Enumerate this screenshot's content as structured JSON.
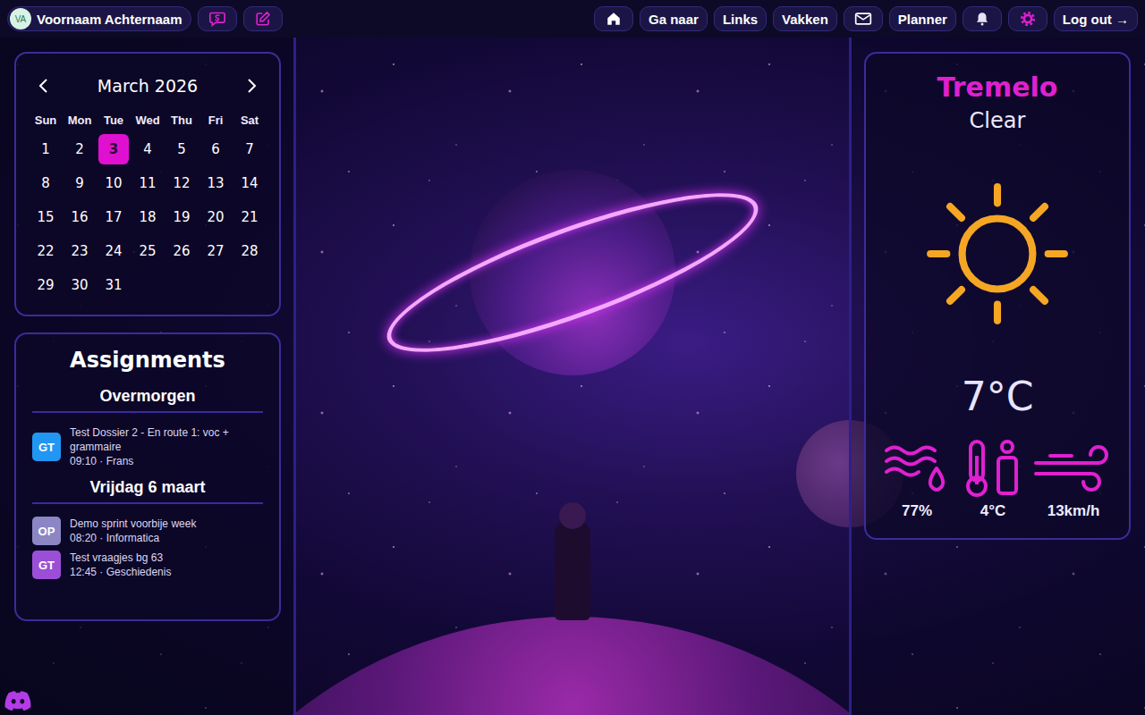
{
  "user": {
    "initials": "VA",
    "name": "Voornaam Achternaam"
  },
  "nav": [
    {
      "kind": "icon"
    },
    {
      "kind": "text",
      "label": "Ga naar"
    },
    {
      "kind": "text",
      "label": "Links"
    },
    {
      "kind": "text",
      "label": "Vakken"
    },
    {
      "kind": "icon"
    },
    {
      "kind": "text",
      "label": "Planner"
    },
    {
      "kind": "icon"
    },
    {
      "kind": "icon"
    },
    {
      "kind": "text",
      "label": "Log out →"
    }
  ],
  "calendar": {
    "month": "March 2026",
    "weekdays": [
      "Sun",
      "Mon",
      "Tue",
      "Wed",
      "Thu",
      "Fri",
      "Sat"
    ],
    "days": [
      {
        "label": "1",
        "selected": false
      },
      {
        "label": "2",
        "selected": false
      },
      {
        "label": "3",
        "selected": true
      },
      {
        "label": "4",
        "selected": false
      },
      {
        "label": "5",
        "selected": false
      },
      {
        "label": "6",
        "selected": false
      },
      {
        "label": "7",
        "selected": false
      },
      {
        "label": "8",
        "selected": false
      },
      {
        "label": "9",
        "selected": false
      },
      {
        "label": "10",
        "selected": false
      },
      {
        "label": "11",
        "selected": false
      },
      {
        "label": "12",
        "selected": false
      },
      {
        "label": "13",
        "selected": false
      },
      {
        "label": "14",
        "selected": false
      },
      {
        "label": "15",
        "selected": false
      },
      {
        "label": "16",
        "selected": false
      },
      {
        "label": "17",
        "selected": false
      },
      {
        "label": "18",
        "selected": false
      },
      {
        "label": "19",
        "selected": false
      },
      {
        "label": "20",
        "selected": false
      },
      {
        "label": "21",
        "selected": false
      },
      {
        "label": "22",
        "selected": false
      },
      {
        "label": "23",
        "selected": false
      },
      {
        "label": "24",
        "selected": false
      },
      {
        "label": "25",
        "selected": false
      },
      {
        "label": "26",
        "selected": false
      },
      {
        "label": "27",
        "selected": false
      },
      {
        "label": "28",
        "selected": false
      },
      {
        "label": "29",
        "selected": false
      },
      {
        "label": "30",
        "selected": false
      },
      {
        "label": "31",
        "selected": false
      }
    ]
  },
  "assignments": {
    "title": "Assignments",
    "groups": [
      {
        "label": "Overmorgen",
        "items": [
          {
            "badge": "GT",
            "title": "Test Dossier 2 - En route 1: voc + grammaire",
            "meta": "09:10 · Frans",
            "color": "#2196f3"
          }
        ]
      },
      {
        "label": "Vrijdag 6 maart",
        "items": [
          {
            "badge": "OP",
            "title": "Demo sprint voorbije week",
            "meta": "08:20 · Informatica",
            "color": "#8c86c4"
          },
          {
            "badge": "GT",
            "title": "Test vraagjes bg 63",
            "meta": "12:45 · Geschiedenis",
            "color": "#9a4fd6"
          }
        ]
      }
    ]
  },
  "weather": {
    "city": "Tremelo",
    "condition": "Clear",
    "temperature": "7°C",
    "stats": [
      {
        "value": "77%"
      },
      {
        "value": "4°C"
      },
      {
        "value": "13km/h"
      }
    ]
  }
}
